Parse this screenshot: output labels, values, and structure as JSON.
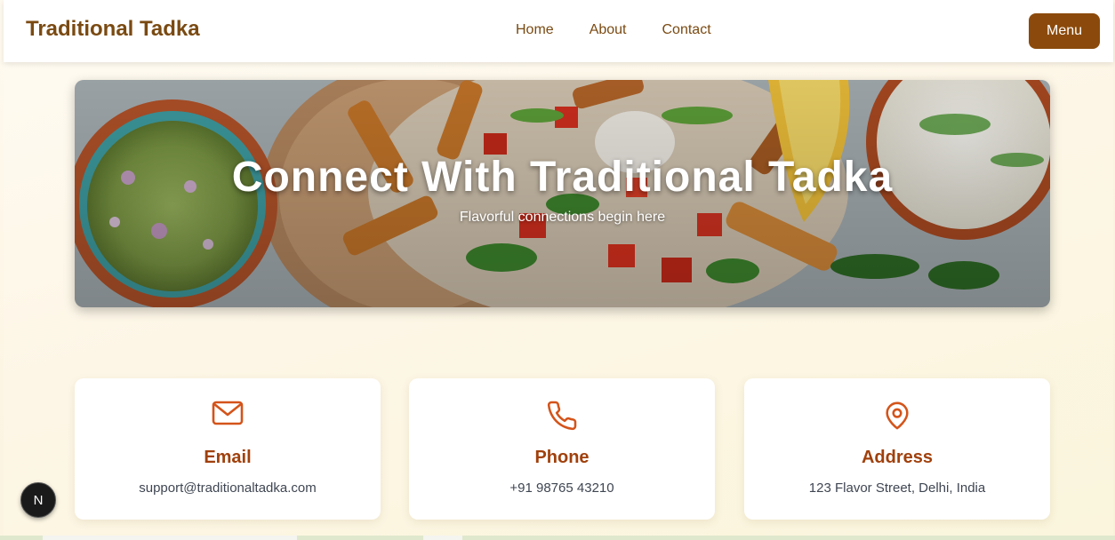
{
  "header": {
    "brand": "Traditional Tadka",
    "nav": [
      "Home",
      "About",
      "Contact"
    ],
    "menu_label": "Menu"
  },
  "hero": {
    "title": "Connect With Traditional Tadka",
    "subtitle": "Flavorful connections begin here"
  },
  "contact_cards": [
    {
      "icon": "mail-icon",
      "title": "Email",
      "value": "support@traditionaltadka.com"
    },
    {
      "icon": "phone-icon",
      "title": "Phone",
      "value": "+91 98765 43210"
    },
    {
      "icon": "map-pin-icon",
      "title": "Address",
      "value": "123 Flavor Street, Delhi, India"
    }
  ],
  "dev_badge": {
    "label": "N"
  },
  "colors": {
    "brand": "#7a4a12",
    "button": "#8b4a0b",
    "accent": "#d4541a",
    "card_title": "#a0400c"
  }
}
